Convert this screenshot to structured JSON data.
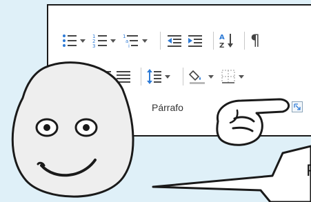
{
  "ribbon": {
    "group_label": "Párrafo",
    "row1": [
      {
        "name": "bullets-button",
        "icon": "bullets-icon"
      },
      {
        "name": "numbering-button",
        "icon": "numbering-icon"
      },
      {
        "name": "multilevel-list-button",
        "icon": "multilevel-list-icon"
      },
      {
        "name": "decrease-indent-button",
        "icon": "decrease-indent-icon"
      },
      {
        "name": "increase-indent-button",
        "icon": "increase-indent-icon"
      },
      {
        "name": "sort-button",
        "icon": "sort-az-icon"
      },
      {
        "name": "show-marks-button",
        "icon": "pilcrow-icon",
        "glyph": "¶"
      }
    ],
    "row2": [
      {
        "name": "align-left-button",
        "icon": "align-left-icon",
        "selected": true
      },
      {
        "name": "align-center-button",
        "icon": "align-center-icon"
      },
      {
        "name": "align-right-button",
        "icon": "align-right-icon"
      },
      {
        "name": "justify-button",
        "icon": "justify-icon"
      },
      {
        "name": "line-spacing-button",
        "icon": "line-spacing-icon"
      },
      {
        "name": "shading-button",
        "icon": "shading-icon"
      },
      {
        "name": "borders-button",
        "icon": "borders-icon"
      }
    ],
    "launcher_icon": "dialog-launcher-icon"
  },
  "speech_bubble": {
    "visible_text": "P"
  },
  "colors": {
    "background": "#dff0f8",
    "accent_blue": "#2e7bd6",
    "selected": "#cfe3f5"
  }
}
